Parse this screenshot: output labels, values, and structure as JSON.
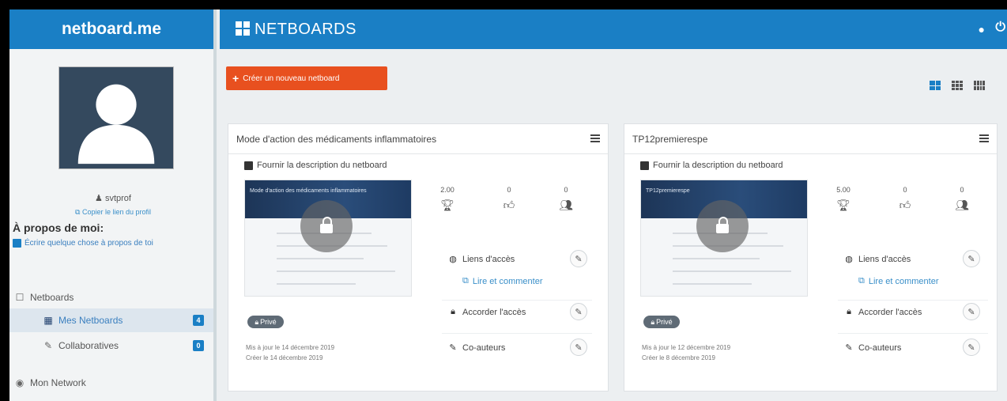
{
  "brand": "netboard.me",
  "topbar": {
    "title": "NETBOARDS",
    "icons": [
      "grid-icon",
      "chat-icon",
      "power-icon"
    ]
  },
  "profile": {
    "username": "svtprof",
    "copy_link": "Copier le lien du profil",
    "about_title": "À propos de moi:",
    "about_edit": "Écrire quelque chose à propos de toi"
  },
  "nav": {
    "netboards": "Netboards",
    "mes_netboards": "Mes Netboards",
    "mes_netboards_count": "4",
    "collaboratives": "Collaboratives",
    "collaboratives_count": "0",
    "network": "Mon Network"
  },
  "create_button": "Créer un nouveau netboard",
  "colors": {
    "brand_blue": "#1a7fc5",
    "create_orange": "#e8501f"
  },
  "cards": [
    {
      "title": "Mode d'action des médicaments inflammatoires",
      "description": "Fournir la description du netboard",
      "thumb_title": "Mode d'action des médicaments inflammatoires",
      "stats": [
        "2.00",
        "0",
        "0"
      ],
      "access_links": "Liens d'accès",
      "read_comment": "Lire et commenter",
      "grant_access": "Accorder l'accès",
      "coauthors": "Co-auteurs",
      "privacy": "Privé",
      "updated": "Mis à jour le 14 décembre 2019",
      "created": "Créer le 14 décembre 2019"
    },
    {
      "title": "TP12premierespe",
      "description": "Fournir la description du netboard",
      "thumb_title": "TP12premierespe",
      "stats": [
        "5.00",
        "0",
        "0"
      ],
      "access_links": "Liens d'accès",
      "read_comment": "Lire et commenter",
      "grant_access": "Accorder l'accès",
      "coauthors": "Co-auteurs",
      "privacy": "Privé",
      "updated": "Mis à jour le 12 décembre 2019",
      "created": "Créer le 8 décembre 2019"
    }
  ]
}
